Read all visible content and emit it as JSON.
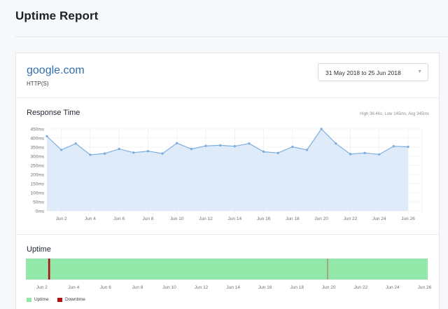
{
  "page": {
    "title": "Uptime Report"
  },
  "site": {
    "name": "google.com",
    "protocol": "HTTP(S)"
  },
  "date_range": {
    "value": "31 May 2018 to 25 Jun 2018"
  },
  "response_time": {
    "heading": "Response Time",
    "summary": "High 36.46s, Low 145ms, Avg 345ms"
  },
  "uptime": {
    "heading": "Uptime",
    "legend": [
      {
        "label": "Uptime",
        "color": "#92e8a8"
      },
      {
        "label": "Downtime",
        "color": "#b01111"
      }
    ]
  },
  "colors": {
    "line": "#7eaee0",
    "fill": "#dce9f8",
    "accent": "#2f6fab"
  },
  "chart_data": [
    {
      "type": "area",
      "title": "Response Time",
      "y_unit": "ms",
      "ylim": [
        0,
        450
      ],
      "y_ticks": [
        "0ms",
        "50ms",
        "100ms",
        "150ms",
        "200ms",
        "250ms",
        "300ms",
        "350ms",
        "400ms",
        "450ms"
      ],
      "x": [
        "Jun 1",
        "Jun 2",
        "Jun 3",
        "Jun 4",
        "Jun 5",
        "Jun 6",
        "Jun 7",
        "Jun 8",
        "Jun 9",
        "Jun 10",
        "Jun 11",
        "Jun 12",
        "Jun 13",
        "Jun 14",
        "Jun 15",
        "Jun 16",
        "Jun 17",
        "Jun 18",
        "Jun 19",
        "Jun 20",
        "Jun 21",
        "Jun 22",
        "Jun 23",
        "Jun 24",
        "Jun 25",
        "Jun 26"
      ],
      "x_tick_labels": [
        "Jun 2",
        "Jun 4",
        "Jun 6",
        "Jun 8",
        "Jun 10",
        "Jun 12",
        "Jun 14",
        "Jun 16",
        "Jun 18",
        "Jun 20",
        "Jun 22",
        "Jun 24",
        "Jun 26"
      ],
      "values": [
        410,
        335,
        370,
        308,
        315,
        340,
        320,
        328,
        315,
        372,
        340,
        357,
        360,
        355,
        370,
        325,
        318,
        352,
        335,
        450,
        370,
        312,
        318,
        310,
        355,
        352
      ],
      "grid": true
    },
    {
      "type": "timeline",
      "title": "Uptime",
      "range": [
        "Jun 1",
        "Jun 26"
      ],
      "x_tick_labels": [
        "Jun 2",
        "Jun 4",
        "Jun 6",
        "Jun 8",
        "Jun 10",
        "Jun 12",
        "Jun 14",
        "Jun 16",
        "Jun 18",
        "Jun 20",
        "Jun 22",
        "Jun 24",
        "Jun 26"
      ],
      "downtime_events": [
        {
          "day": 2.4,
          "severity": "major"
        },
        {
          "day": 19.9,
          "severity": "minor"
        }
      ]
    }
  ]
}
